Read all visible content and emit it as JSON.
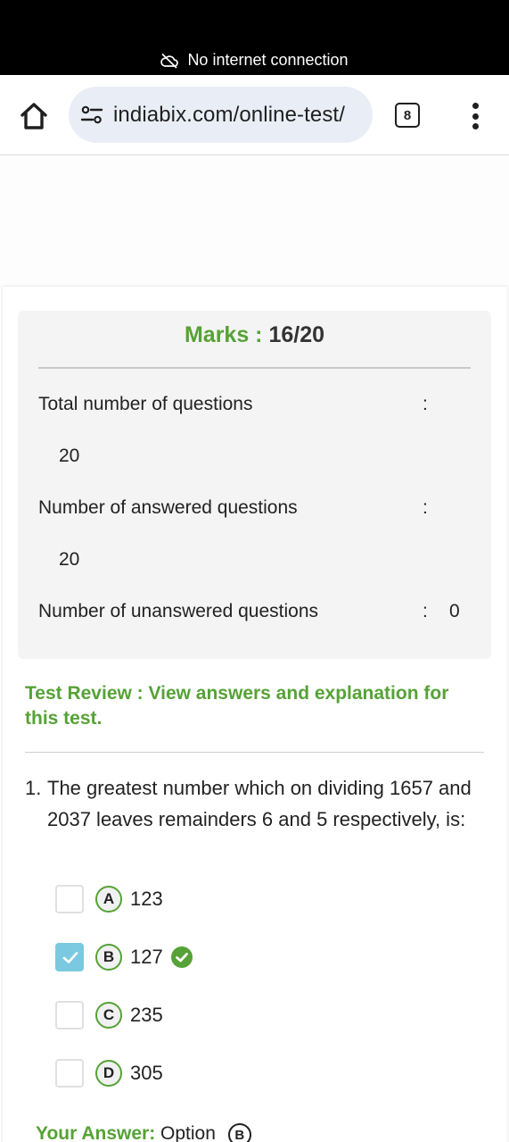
{
  "status_bar": {
    "network_text": "No internet connection",
    "icon": "cloud-off-icon"
  },
  "browser": {
    "url": "indiabix.com/online-test/",
    "tab_count": "8",
    "icons": [
      "home-icon",
      "site-settings-icon",
      "more-vert-icon"
    ]
  },
  "summary": {
    "marks_label": "Marks :",
    "marks_value": "16/20",
    "rows": [
      {
        "label": "Total number of questions",
        "colon": ":",
        "value": "20"
      },
      {
        "label": "Number of answered questions",
        "colon": ":",
        "value": "20"
      },
      {
        "label": "Number of unanswered questions",
        "colon": ":",
        "value": "0"
      }
    ]
  },
  "review_heading": "Test Review : View answers and explanation for this test.",
  "question": {
    "number": "1.",
    "text": "The greatest number which on dividing 1657 and 2037 leaves remainders 6 and 5 respectively, is:",
    "options": [
      {
        "letter": "A",
        "text": "123",
        "checked": false,
        "correct": false
      },
      {
        "letter": "B",
        "text": "127",
        "checked": true,
        "correct": true
      },
      {
        "letter": "C",
        "text": "235",
        "checked": false,
        "correct": false
      },
      {
        "letter": "D",
        "text": "305",
        "checked": false,
        "correct": false
      }
    ]
  },
  "your_answer": {
    "label": "Your Answer:",
    "text": "Option",
    "letter": "B"
  },
  "colors": {
    "accent_green": "#56a236",
    "checkbox_checked": "#7ac9e0",
    "url_bar": "#e9eef6"
  }
}
